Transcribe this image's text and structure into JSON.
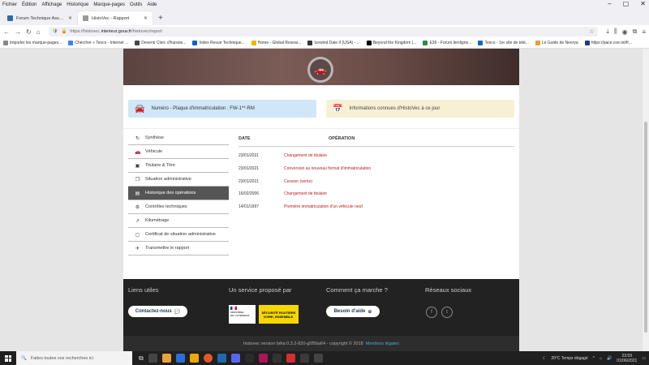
{
  "menu": {
    "items": [
      "Fichier",
      "Édition",
      "Affichage",
      "Historique",
      "Marque-pages",
      "Outils",
      "Aide"
    ],
    "window_controls": [
      "–",
      "▢",
      "✕"
    ]
  },
  "tabs": [
    {
      "label": "Forum Technique Associatif de",
      "favicon_color": "#2b6cb0"
    },
    {
      "label": "HistoVec - Rapport",
      "favicon_color": "#999999"
    }
  ],
  "newtab": "+",
  "nav": {
    "back": "←",
    "forward": "→",
    "reload": "↻",
    "home": "⌂"
  },
  "url": {
    "prefix": "https://histovec.",
    "domain": "interieur.gouv.fr",
    "path": "/histovec/report"
  },
  "bookmarks": [
    {
      "label": "Importer les marque-pages...",
      "color": "#888888"
    },
    {
      "label": "Chercher « Tesco - Internet ...",
      "color": "#3b82f6"
    },
    {
      "label": "Devenir Clerc d'huissie...",
      "color": "#444444"
    },
    {
      "label": "Index Revue Technique...",
      "color": "#0a66c2"
    },
    {
      "label": "Home - Global Resear...",
      "color": "#f0b400"
    },
    {
      "label": "Icewind Dale II (USA) - ...",
      "color": "#333333"
    },
    {
      "label": "Beyond the Kingdom (...",
      "color": "#000000"
    },
    {
      "label": "E36 - Forum tienligne...",
      "color": "#2d8a44"
    },
    {
      "label": "Tesco - 1er site de télé...",
      "color": "#1565c0"
    },
    {
      "label": "Le Guide de Neerya",
      "color": "#e0a030"
    },
    {
      "label": "https://pace.coe.int/fr...",
      "color": "#1e3a8a"
    }
  ],
  "hero": {
    "icon": "🚗"
  },
  "plate_box": {
    "text": "Numéro - Plaque d'immatriculation : FW-1**-RM"
  },
  "info_box": {
    "text": "Informations connues d'HistoVec à ce jour"
  },
  "sidebar": {
    "items": [
      {
        "label": "Synthèse",
        "icon": "↻"
      },
      {
        "label": "Véhicule",
        "icon": "🚗"
      },
      {
        "label": "Titulaire & Titre",
        "icon": "▣"
      },
      {
        "label": "Situation administrative",
        "icon": "❐"
      },
      {
        "label": "Historique des opérations",
        "icon": "▤"
      },
      {
        "label": "Contrôles techniques",
        "icon": "⚙"
      },
      {
        "label": "Kilométrage",
        "icon": "↗"
      },
      {
        "label": "Certificat de situation administrative",
        "icon": "▢"
      },
      {
        "label": "Transmettre le rapport",
        "icon": "✈"
      }
    ],
    "active_index": 4
  },
  "operations": {
    "headers": {
      "date": "DATE",
      "operation": "OPÉRATION"
    },
    "rows": [
      {
        "date": "23/01/2021",
        "operation": "Changement de titulaire"
      },
      {
        "date": "23/01/2021",
        "operation": "Conversion au nouveau format d'immatriculation"
      },
      {
        "date": "23/01/2021",
        "operation": "Cession (vente)"
      },
      {
        "date": "16/02/2006",
        "operation": "Changement de titulaire"
      },
      {
        "date": "14/01/1997",
        "operation": "Première immatriculation d'un véhicule neuf"
      }
    ]
  },
  "footer": {
    "col1_title": "Liens utiles",
    "col2_title": "Un service proposé par",
    "col3_title": "Comment ça marche ?",
    "col4_title": "Réseaux sociaux",
    "contact_button": "Contactez-nous",
    "help_button": "Besoin d'aide",
    "logo_ministere": {
      "line1": "MINISTÈRE",
      "line2": "DE L'INTÉRIEUR"
    },
    "logo_securite": {
      "line1": "SÉCURITÉ ROUTIÈRE",
      "line2": "VIVRE, ENSEMBLE."
    },
    "social": [
      "f",
      "t"
    ]
  },
  "copyright": {
    "text": "histovec version bêta 0.3.2-820-g0f56a64 - copyright © 2018",
    "link": "Mentions légales"
  },
  "taskbar": {
    "search_placeholder": "Faites toutes vos recherches ici",
    "weather": "20°C  Temps dégagé",
    "time": "23:59",
    "date": "01/06/2021",
    "apps": [
      "#444444",
      "#e8a33a",
      "#2a6fd6",
      "#f0a500",
      "#e25822",
      "#1e6ab1",
      "#5865f2",
      "#2b2b2b",
      "#ad1457",
      "#333333",
      "#d32f2f",
      "#3a3a3a",
      "#444444"
    ]
  }
}
